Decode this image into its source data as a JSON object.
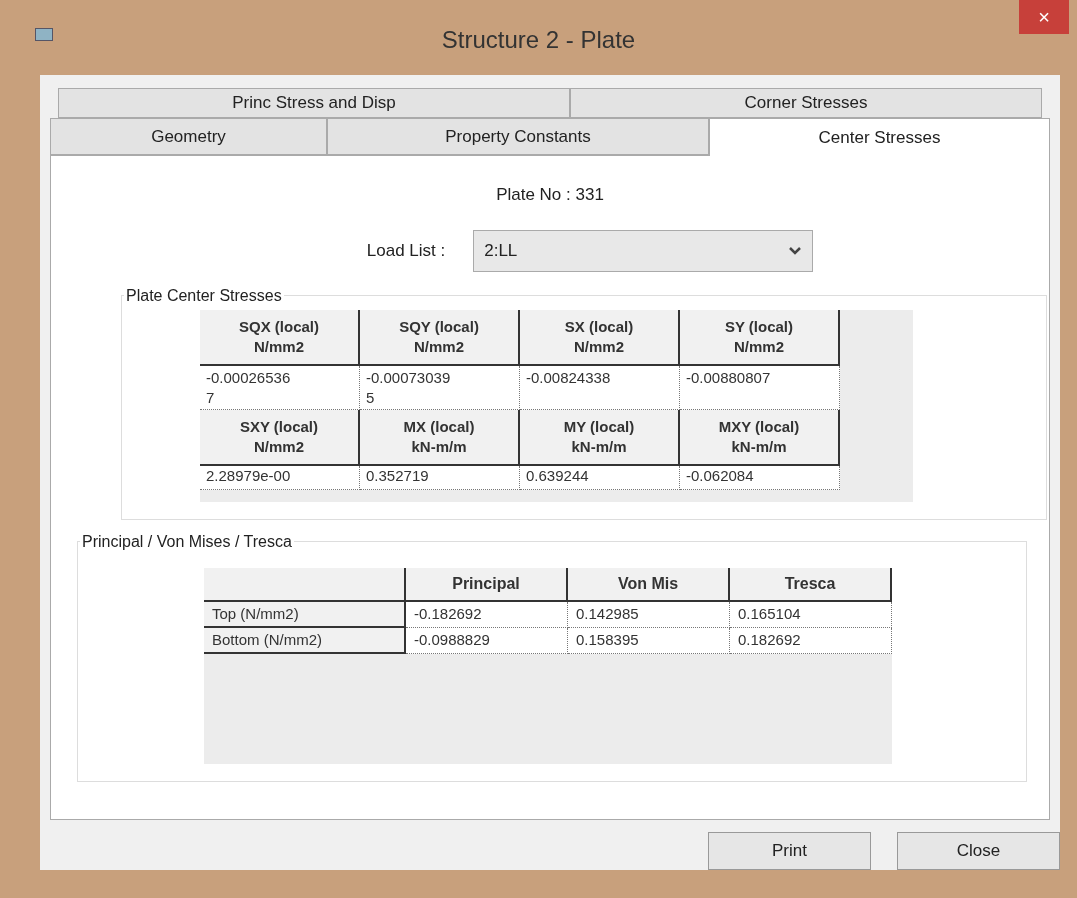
{
  "window": {
    "title": "Structure 2 - Plate",
    "close": "×"
  },
  "tab_rows": [
    [
      {
        "label": "Princ Stress and Disp",
        "selected": false
      },
      {
        "label": "Corner Stresses",
        "selected": false
      }
    ],
    [
      {
        "label": "Geometry",
        "selected": false
      },
      {
        "label": "Property  Constants",
        "selected": false
      },
      {
        "label": "Center Stresses",
        "selected": true
      }
    ]
  ],
  "plate_no": "Plate No : 331",
  "load_list": {
    "label": "Load List :",
    "value": "2:LL"
  },
  "center_stresses": {
    "title": "Plate Center Stresses",
    "blocks": [
      {
        "headers": [
          [
            "SQX (local)",
            "N/mm2"
          ],
          [
            "SQY (local)",
            "N/mm2"
          ],
          [
            "SX (local)",
            "N/mm2"
          ],
          [
            "SY (local)",
            "N/mm2"
          ]
        ],
        "values": [
          "-0.00026536\n7",
          "-0.00073039\n5",
          "-0.00824338",
          "-0.00880807"
        ]
      },
      {
        "headers": [
          [
            "SXY (local)",
            "N/mm2"
          ],
          [
            "MX (local)",
            "kN-m/m"
          ],
          [
            "MY (local)",
            "kN-m/m"
          ],
          [
            "MXY (local)",
            "kN-m/m"
          ]
        ],
        "values": [
          "2.28979e-00",
          "0.352719",
          "0.639244",
          "-0.062084"
        ]
      }
    ]
  },
  "principal": {
    "title": "Principal / Von Mises / Tresca",
    "columns": [
      "Principal",
      "Von Mis",
      "Tresca"
    ],
    "rows": [
      {
        "label": "Top (N/mm2)",
        "values": [
          "-0.182692",
          "0.142985",
          "0.165104"
        ]
      },
      {
        "label": "Bottom (N/mm2)",
        "values": [
          "-0.0988829",
          "0.158395",
          "0.182692"
        ]
      }
    ]
  },
  "buttons": [
    "Print",
    "Close"
  ]
}
